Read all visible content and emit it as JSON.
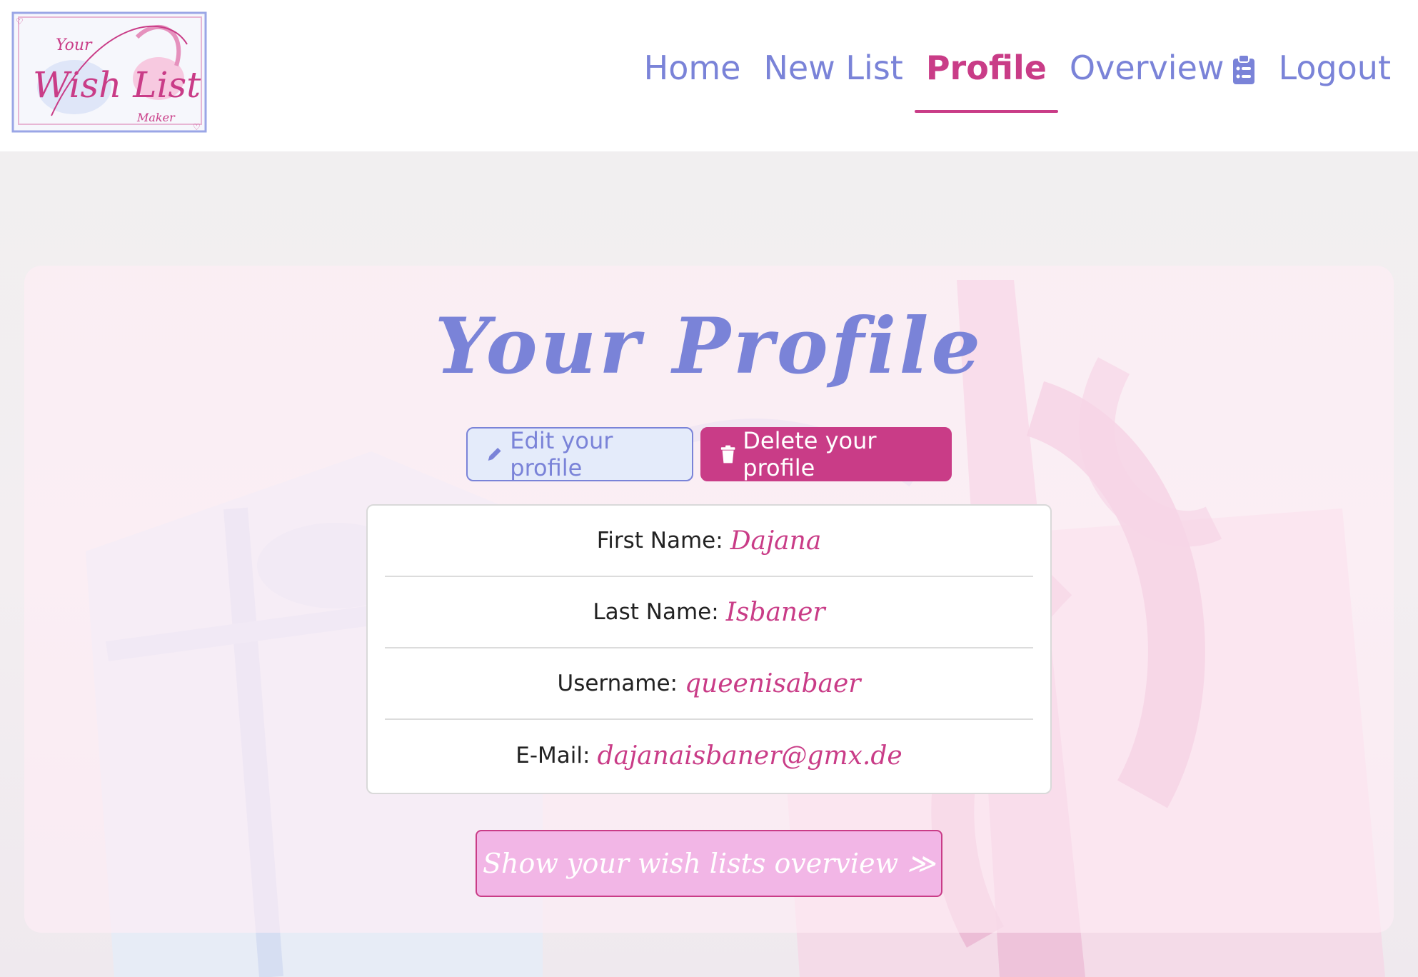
{
  "logo": {
    "line1": "Your",
    "line2": "Wish List",
    "line3": "Maker"
  },
  "nav": {
    "home": "Home",
    "new_list": "New List",
    "profile": "Profile",
    "overview": "Overview",
    "logout": "Logout",
    "active": "profile"
  },
  "colors": {
    "accent_blue": "#7a83d8",
    "accent_pink": "#c93c87",
    "button_light_pink": "#f2b6e6"
  },
  "icons": {
    "overview": "clipboard-list-icon",
    "edit": "pencil-icon",
    "delete": "trash-icon"
  },
  "page": {
    "title": "Your Profile"
  },
  "actions": {
    "edit_label": "Edit your profile",
    "delete_label": "Delete your profile",
    "overview_label": "Show your wish lists overview ≫"
  },
  "profile": {
    "first_name_label": "First Name:",
    "first_name": "Dajana",
    "last_name_label": "Last Name:",
    "last_name": "Isbaner",
    "username_label": "Username:",
    "username": "queenisabaer",
    "email_label": "E-Mail:",
    "email": "dajanaisbaner@gmx.de"
  }
}
